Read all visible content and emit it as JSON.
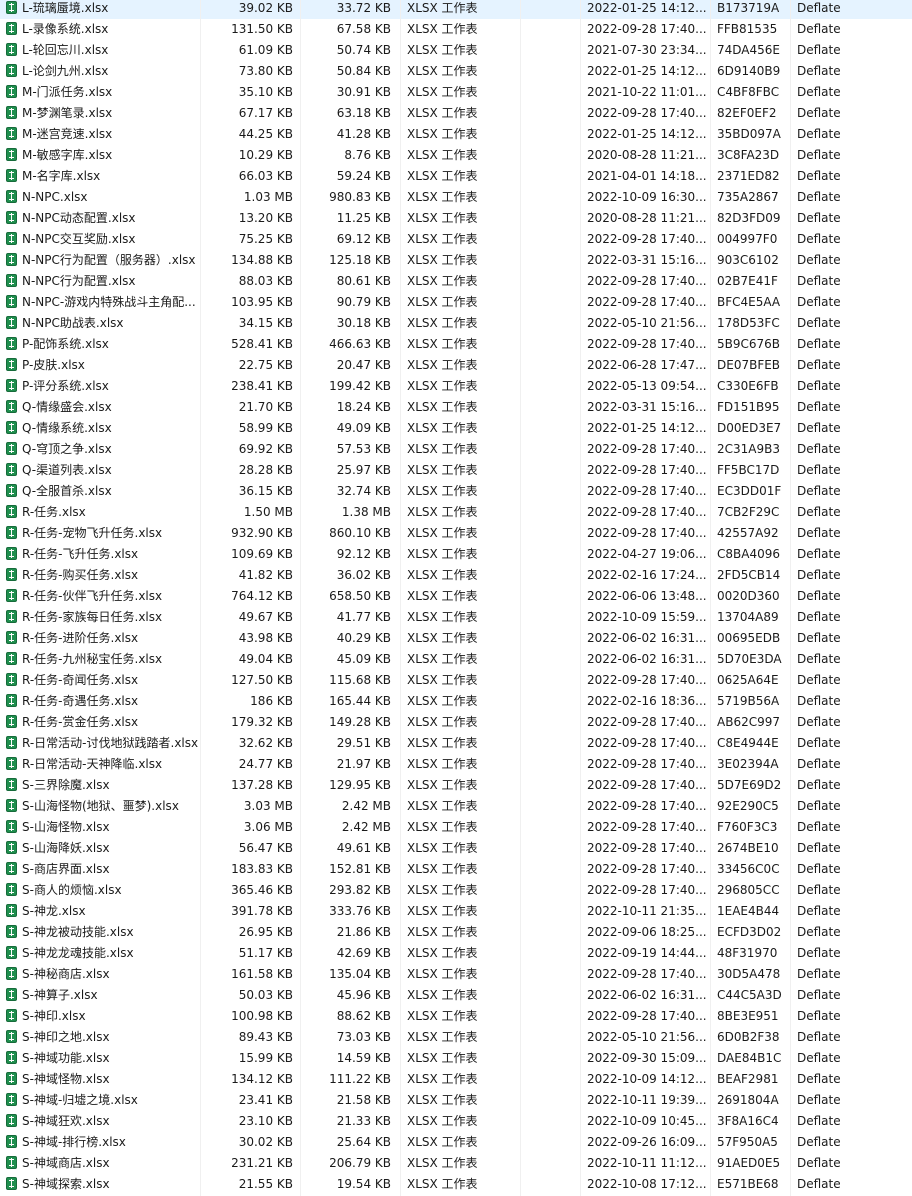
{
  "rows": [
    {
      "name": "L-琉璃蜃境.xlsx",
      "size": "39.02 KB",
      "packed": "33.72 KB",
      "type": "XLSX 工作表",
      "modified": "2022-01-25 14:12...",
      "crc": "B173719A",
      "method": "Deflate"
    },
    {
      "name": "L-录像系统.xlsx",
      "size": "131.50 KB",
      "packed": "67.58 KB",
      "type": "XLSX 工作表",
      "modified": "2022-09-28 17:40...",
      "crc": "FFB81535",
      "method": "Deflate"
    },
    {
      "name": "L-轮回忘川.xlsx",
      "size": "61.09 KB",
      "packed": "50.74 KB",
      "type": "XLSX 工作表",
      "modified": "2021-07-30 23:34...",
      "crc": "74DA456E",
      "method": "Deflate"
    },
    {
      "name": "L-论剑九州.xlsx",
      "size": "73.80 KB",
      "packed": "50.84 KB",
      "type": "XLSX 工作表",
      "modified": "2022-01-25 14:12...",
      "crc": "6D9140B9",
      "method": "Deflate"
    },
    {
      "name": "M-门派任务.xlsx",
      "size": "35.10 KB",
      "packed": "30.91 KB",
      "type": "XLSX 工作表",
      "modified": "2021-10-22 11:01...",
      "crc": "C4BF8FBC",
      "method": "Deflate"
    },
    {
      "name": "M-梦渊笔录.xlsx",
      "size": "67.17 KB",
      "packed": "63.18 KB",
      "type": "XLSX 工作表",
      "modified": "2022-09-28 17:40...",
      "crc": "82EF0EF2",
      "method": "Deflate"
    },
    {
      "name": "M-迷宫竞速.xlsx",
      "size": "44.25 KB",
      "packed": "41.28 KB",
      "type": "XLSX 工作表",
      "modified": "2022-01-25 14:12...",
      "crc": "35BD097A",
      "method": "Deflate"
    },
    {
      "name": "M-敏感字库.xlsx",
      "size": "10.29 KB",
      "packed": "8.76 KB",
      "type": "XLSX 工作表",
      "modified": "2020-08-28 11:21...",
      "crc": "3C8FA23D",
      "method": "Deflate"
    },
    {
      "name": "M-名字库.xlsx",
      "size": "66.03 KB",
      "packed": "59.24 KB",
      "type": "XLSX 工作表",
      "modified": "2021-04-01 14:18...",
      "crc": "2371ED82",
      "method": "Deflate"
    },
    {
      "name": "N-NPC.xlsx",
      "size": "1.03 MB",
      "packed": "980.83 KB",
      "type": "XLSX 工作表",
      "modified": "2022-10-09 16:30...",
      "crc": "735A2867",
      "method": "Deflate"
    },
    {
      "name": "N-NPC动态配置.xlsx",
      "size": "13.20 KB",
      "packed": "11.25 KB",
      "type": "XLSX 工作表",
      "modified": "2020-08-28 11:21...",
      "crc": "82D3FD09",
      "method": "Deflate"
    },
    {
      "name": "N-NPC交互奖励.xlsx",
      "size": "75.25 KB",
      "packed": "69.12 KB",
      "type": "XLSX 工作表",
      "modified": "2022-09-28 17:40...",
      "crc": "004997F0",
      "method": "Deflate"
    },
    {
      "name": "N-NPC行为配置（服务器）.xlsx",
      "size": "134.88 KB",
      "packed": "125.18 KB",
      "type": "XLSX 工作表",
      "modified": "2022-03-31 15:16...",
      "crc": "903C6102",
      "method": "Deflate"
    },
    {
      "name": "N-NPC行为配置.xlsx",
      "size": "88.03 KB",
      "packed": "80.61 KB",
      "type": "XLSX 工作表",
      "modified": "2022-09-28 17:40...",
      "crc": "02B7E41F",
      "method": "Deflate"
    },
    {
      "name": "N-NPC-游戏内特殊战斗主角配...",
      "size": "103.95 KB",
      "packed": "90.79 KB",
      "type": "XLSX 工作表",
      "modified": "2022-09-28 17:40...",
      "crc": "BFC4E5AA",
      "method": "Deflate"
    },
    {
      "name": "N-NPC助战表.xlsx",
      "size": "34.15 KB",
      "packed": "30.18 KB",
      "type": "XLSX 工作表",
      "modified": "2022-05-10 21:56...",
      "crc": "178D53FC",
      "method": "Deflate"
    },
    {
      "name": "P-配饰系统.xlsx",
      "size": "528.41 KB",
      "packed": "466.63 KB",
      "type": "XLSX 工作表",
      "modified": "2022-09-28 17:40...",
      "crc": "5B9C676B",
      "method": "Deflate"
    },
    {
      "name": "P-皮肤.xlsx",
      "size": "22.75 KB",
      "packed": "20.47 KB",
      "type": "XLSX 工作表",
      "modified": "2022-06-28 17:47...",
      "crc": "DE07BFEB",
      "method": "Deflate"
    },
    {
      "name": "P-评分系统.xlsx",
      "size": "238.41 KB",
      "packed": "199.42 KB",
      "type": "XLSX 工作表",
      "modified": "2022-05-13 09:54...",
      "crc": "C330E6FB",
      "method": "Deflate"
    },
    {
      "name": "Q-情缘盛会.xlsx",
      "size": "21.70 KB",
      "packed": "18.24 KB",
      "type": "XLSX 工作表",
      "modified": "2022-03-31 15:16...",
      "crc": "FD151B95",
      "method": "Deflate"
    },
    {
      "name": "Q-情缘系统.xlsx",
      "size": "58.99 KB",
      "packed": "49.09 KB",
      "type": "XLSX 工作表",
      "modified": "2022-01-25 14:12...",
      "crc": "D00ED3E7",
      "method": "Deflate"
    },
    {
      "name": "Q-穹顶之争.xlsx",
      "size": "69.92 KB",
      "packed": "57.53 KB",
      "type": "XLSX 工作表",
      "modified": "2022-09-28 17:40...",
      "crc": "2C31A9B3",
      "method": "Deflate"
    },
    {
      "name": "Q-渠道列表.xlsx",
      "size": "28.28 KB",
      "packed": "25.97 KB",
      "type": "XLSX 工作表",
      "modified": "2022-09-28 17:40...",
      "crc": "FF5BC17D",
      "method": "Deflate"
    },
    {
      "name": "Q-全服首杀.xlsx",
      "size": "36.15 KB",
      "packed": "32.74 KB",
      "type": "XLSX 工作表",
      "modified": "2022-09-28 17:40...",
      "crc": "EC3DD01F",
      "method": "Deflate"
    },
    {
      "name": "R-任务.xlsx",
      "size": "1.50 MB",
      "packed": "1.38 MB",
      "type": "XLSX 工作表",
      "modified": "2022-09-28 17:40...",
      "crc": "7CB2F29C",
      "method": "Deflate"
    },
    {
      "name": "R-任务-宠物飞升任务.xlsx",
      "size": "932.90 KB",
      "packed": "860.10 KB",
      "type": "XLSX 工作表",
      "modified": "2022-09-28 17:40...",
      "crc": "42557A92",
      "method": "Deflate"
    },
    {
      "name": "R-任务-飞升任务.xlsx",
      "size": "109.69 KB",
      "packed": "92.12 KB",
      "type": "XLSX 工作表",
      "modified": "2022-04-27 19:06...",
      "crc": "C8BA4096",
      "method": "Deflate"
    },
    {
      "name": "R-任务-购买任务.xlsx",
      "size": "41.82 KB",
      "packed": "36.02 KB",
      "type": "XLSX 工作表",
      "modified": "2022-02-16 17:24...",
      "crc": "2FD5CB14",
      "method": "Deflate"
    },
    {
      "name": "R-任务-伙伴飞升任务.xlsx",
      "size": "764.12 KB",
      "packed": "658.50 KB",
      "type": "XLSX 工作表",
      "modified": "2022-06-06 13:48...",
      "crc": "0020D360",
      "method": "Deflate"
    },
    {
      "name": "R-任务-家族每日任务.xlsx",
      "size": "49.67 KB",
      "packed": "41.77 KB",
      "type": "XLSX 工作表",
      "modified": "2022-10-09 15:59...",
      "crc": "13704A89",
      "method": "Deflate"
    },
    {
      "name": "R-任务-进阶任务.xlsx",
      "size": "43.98 KB",
      "packed": "40.29 KB",
      "type": "XLSX 工作表",
      "modified": "2022-06-02 16:31...",
      "crc": "00695EDB",
      "method": "Deflate"
    },
    {
      "name": "R-任务-九州秘宝任务.xlsx",
      "size": "49.04 KB",
      "packed": "45.09 KB",
      "type": "XLSX 工作表",
      "modified": "2022-06-02 16:31...",
      "crc": "5D70E3DA",
      "method": "Deflate"
    },
    {
      "name": "R-任务-奇闻任务.xlsx",
      "size": "127.50 KB",
      "packed": "115.68 KB",
      "type": "XLSX 工作表",
      "modified": "2022-09-28 17:40...",
      "crc": "0625A64E",
      "method": "Deflate"
    },
    {
      "name": "R-任务-奇遇任务.xlsx",
      "size": "186 KB",
      "packed": "165.44 KB",
      "type": "XLSX 工作表",
      "modified": "2022-02-16 18:36...",
      "crc": "5719B56A",
      "method": "Deflate"
    },
    {
      "name": "R-任务-赏金任务.xlsx",
      "size": "179.32 KB",
      "packed": "149.28 KB",
      "type": "XLSX 工作表",
      "modified": "2022-09-28 17:40...",
      "crc": "AB62C997",
      "method": "Deflate"
    },
    {
      "name": "R-日常活动-讨伐地狱践踏者.xlsx",
      "size": "32.62 KB",
      "packed": "29.51 KB",
      "type": "XLSX 工作表",
      "modified": "2022-09-28 17:40...",
      "crc": "C8E4944E",
      "method": "Deflate"
    },
    {
      "name": "R-日常活动-天神降临.xlsx",
      "size": "24.77 KB",
      "packed": "21.97 KB",
      "type": "XLSX 工作表",
      "modified": "2022-09-28 17:40...",
      "crc": "3E02394A",
      "method": "Deflate"
    },
    {
      "name": "S-三界除魔.xlsx",
      "size": "137.28 KB",
      "packed": "129.95 KB",
      "type": "XLSX 工作表",
      "modified": "2022-09-28 17:40...",
      "crc": "5D7E69D2",
      "method": "Deflate"
    },
    {
      "name": "S-山海怪物(地狱、噩梦).xlsx",
      "size": "3.03 MB",
      "packed": "2.42 MB",
      "type": "XLSX 工作表",
      "modified": "2022-09-28 17:40...",
      "crc": "92E290C5",
      "method": "Deflate"
    },
    {
      "name": "S-山海怪物.xlsx",
      "size": "3.06 MB",
      "packed": "2.42 MB",
      "type": "XLSX 工作表",
      "modified": "2022-09-28 17:40...",
      "crc": "F760F3C3",
      "method": "Deflate"
    },
    {
      "name": "S-山海降妖.xlsx",
      "size": "56.47 KB",
      "packed": "49.61 KB",
      "type": "XLSX 工作表",
      "modified": "2022-09-28 17:40...",
      "crc": "2674BE10",
      "method": "Deflate"
    },
    {
      "name": "S-商店界面.xlsx",
      "size": "183.83 KB",
      "packed": "152.81 KB",
      "type": "XLSX 工作表",
      "modified": "2022-09-28 17:40...",
      "crc": "33456C0C",
      "method": "Deflate"
    },
    {
      "name": "S-商人的烦恼.xlsx",
      "size": "365.46 KB",
      "packed": "293.82 KB",
      "type": "XLSX 工作表",
      "modified": "2022-09-28 17:40...",
      "crc": "296805CC",
      "method": "Deflate"
    },
    {
      "name": "S-神龙.xlsx",
      "size": "391.78 KB",
      "packed": "333.76 KB",
      "type": "XLSX 工作表",
      "modified": "2022-10-11 21:35...",
      "crc": "1EAE4B44",
      "method": "Deflate"
    },
    {
      "name": "S-神龙被动技能.xlsx",
      "size": "26.95 KB",
      "packed": "21.86 KB",
      "type": "XLSX 工作表",
      "modified": "2022-09-06 18:25...",
      "crc": "ECFD3D02",
      "method": "Deflate"
    },
    {
      "name": "S-神龙龙魂技能.xlsx",
      "size": "51.17 KB",
      "packed": "42.69 KB",
      "type": "XLSX 工作表",
      "modified": "2022-09-19 14:44...",
      "crc": "48F31970",
      "method": "Deflate"
    },
    {
      "name": "S-神秘商店.xlsx",
      "size": "161.58 KB",
      "packed": "135.04 KB",
      "type": "XLSX 工作表",
      "modified": "2022-09-28 17:40...",
      "crc": "30D5A478",
      "method": "Deflate"
    },
    {
      "name": "S-神算子.xlsx",
      "size": "50.03 KB",
      "packed": "45.96 KB",
      "type": "XLSX 工作表",
      "modified": "2022-06-02 16:31...",
      "crc": "C44C5A3D",
      "method": "Deflate"
    },
    {
      "name": "S-神印.xlsx",
      "size": "100.98 KB",
      "packed": "88.62 KB",
      "type": "XLSX 工作表",
      "modified": "2022-09-28 17:40...",
      "crc": "8BE3E951",
      "method": "Deflate"
    },
    {
      "name": "S-神印之地.xlsx",
      "size": "89.43 KB",
      "packed": "73.03 KB",
      "type": "XLSX 工作表",
      "modified": "2022-05-10 21:56...",
      "crc": "6D0B2F38",
      "method": "Deflate"
    },
    {
      "name": "S-神域功能.xlsx",
      "size": "15.99 KB",
      "packed": "14.59 KB",
      "type": "XLSX 工作表",
      "modified": "2022-09-30 15:09...",
      "crc": "DAE84B1C",
      "method": "Deflate"
    },
    {
      "name": "S-神域怪物.xlsx",
      "size": "134.12 KB",
      "packed": "111.22 KB",
      "type": "XLSX 工作表",
      "modified": "2022-10-09 14:12...",
      "crc": "BEAF2981",
      "method": "Deflate"
    },
    {
      "name": "S-神域-归墟之境.xlsx",
      "size": "23.41 KB",
      "packed": "21.58 KB",
      "type": "XLSX 工作表",
      "modified": "2022-10-11 19:39...",
      "crc": "2691804A",
      "method": "Deflate"
    },
    {
      "name": "S-神域狂欢.xlsx",
      "size": "23.10 KB",
      "packed": "21.33 KB",
      "type": "XLSX 工作表",
      "modified": "2022-10-09 10:45...",
      "crc": "3F8A16C4",
      "method": "Deflate"
    },
    {
      "name": "S-神域-排行榜.xlsx",
      "size": "30.02 KB",
      "packed": "25.64 KB",
      "type": "XLSX 工作表",
      "modified": "2022-09-26 16:09...",
      "crc": "57F950A5",
      "method": "Deflate"
    },
    {
      "name": "S-神域商店.xlsx",
      "size": "231.21 KB",
      "packed": "206.79 KB",
      "type": "XLSX 工作表",
      "modified": "2022-10-11 11:12...",
      "crc": "91AED0E5",
      "method": "Deflate"
    },
    {
      "name": "S-神域探索.xlsx",
      "size": "21.55 KB",
      "packed": "19.54 KB",
      "type": "XLSX 工作表",
      "modified": "2022-10-08 17:12...",
      "crc": "E571BE68",
      "method": "Deflate"
    }
  ]
}
